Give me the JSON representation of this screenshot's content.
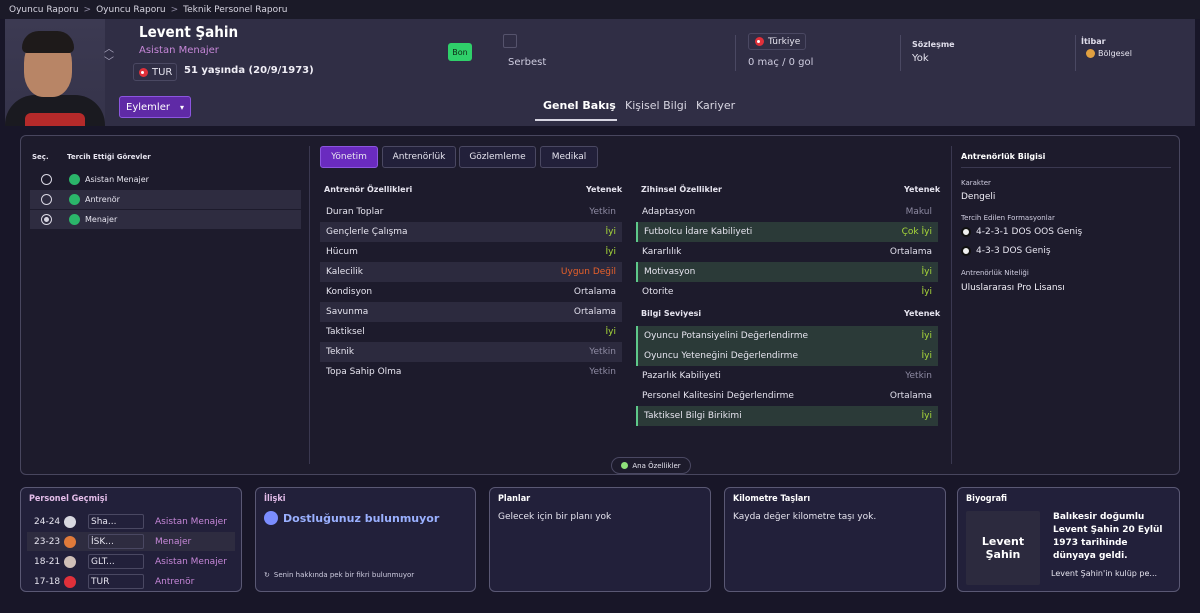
{
  "breadcrumb": [
    "Oyuncu Raporu",
    "Oyuncu Raporu",
    "Teknik Personel Raporu"
  ],
  "person": {
    "name": "Levent Şahin",
    "role": "Asistan Menajer",
    "nationality": "TUR",
    "age": "51 yaşında (20/9/1973)"
  },
  "header": {
    "badge": "Bon",
    "status": "Serbest",
    "club": "Türkiye",
    "matches": "0 maç / 0 gol",
    "contract_label": "Sözleşme",
    "contract_value": "Yok",
    "reputation_label": "İtibar",
    "reputation_value": "Bölgesel",
    "actions_label": "Eylemler"
  },
  "main_tabs": [
    "Genel Bakış",
    "Kişisel Bilgi",
    "Kariyer"
  ],
  "roles": {
    "col_select": "Seç.",
    "col_roles": "Tercih Ettiği Görevler",
    "items": [
      {
        "label": "Asistan Menajer",
        "selected": false
      },
      {
        "label": "Antrenör",
        "selected": false
      },
      {
        "label": "Menajer",
        "selected": true
      }
    ]
  },
  "sub_tabs": [
    "Yönetim",
    "Antrenörlük",
    "Gözlemleme",
    "Medikal"
  ],
  "coach_attrs": {
    "title": "Antrenör Özellikleri",
    "col": "Yetenek",
    "rows": [
      {
        "name": "Duran Toplar",
        "value": "Yetkin"
      },
      {
        "name": "Gençlerle Çalışma",
        "value": "İyi"
      },
      {
        "name": "Hücum",
        "value": "İyi"
      },
      {
        "name": "Kalecilik",
        "value": "Uygun Değil"
      },
      {
        "name": "Kondisyon",
        "value": "Ortalama"
      },
      {
        "name": "Savunma",
        "value": "Ortalama"
      },
      {
        "name": "Taktiksel",
        "value": "İyi"
      },
      {
        "name": "Teknik",
        "value": "Yetkin"
      },
      {
        "name": "Topa Sahip Olma",
        "value": "Yetkin"
      }
    ]
  },
  "mental_attrs": {
    "title": "Zihinsel Özellikler",
    "col": "Yetenek",
    "rows": [
      {
        "name": "Adaptasyon",
        "value": "Makul"
      },
      {
        "name": "Futbolcu İdare Kabiliyeti",
        "value": "Çok İyi"
      },
      {
        "name": "Kararlılık",
        "value": "Ortalama"
      },
      {
        "name": "Motivasyon",
        "value": "İyi"
      },
      {
        "name": "Otorite",
        "value": "İyi"
      }
    ]
  },
  "knowledge_attrs": {
    "title": "Bilgi Seviyesi",
    "col": "Yetenek",
    "rows": [
      {
        "name": "Oyuncu Potansiyelini Değerlendirme",
        "value": "İyi"
      },
      {
        "name": "Oyuncu Yeteneğini Değerlendirme",
        "value": "İyi"
      },
      {
        "name": "Pazarlık Kabiliyeti",
        "value": "Yetkin"
      },
      {
        "name": "Personel Kalitesini Değerlendirme",
        "value": "Ortalama"
      },
      {
        "name": "Taktiksel Bilgi Birikimi",
        "value": "İyi"
      }
    ]
  },
  "key_attrs_label": "Ana Özellikler",
  "coaching_info": {
    "title": "Antrenörlük Bilgisi",
    "character_label": "Karakter",
    "character_value": "Dengeli",
    "formations_label": "Tercih Edilen Formasyonlar",
    "formations": [
      "4-2-3-1 DOS OOS Geniş",
      "4-3-3 DOS Geniş"
    ],
    "qualification_label": "Antrenörlük Niteliği",
    "qualification_value": "Uluslararası Pro Lisansı"
  },
  "history": {
    "title": "Personel Geçmişi",
    "rows": [
      {
        "years": "24-24",
        "club": "Sha...",
        "role": "Asistan Menajer"
      },
      {
        "years": "23-23",
        "club": "İSK...",
        "role": "Menajer"
      },
      {
        "years": "18-21",
        "club": "GLT...",
        "role": "Asistan Menajer"
      },
      {
        "years": "17-18",
        "club": "TUR",
        "role": "Antrenör"
      }
    ]
  },
  "relationship": {
    "title": "İlişki",
    "main": "Dostluğunuz bulunmuyor",
    "sub": "Senin hakkında pek bir fikri bulunmuyor"
  },
  "plans": {
    "title": "Planlar",
    "text": "Gelecek için bir planı yok"
  },
  "milestones": {
    "title": "Kilometre Taşları",
    "text": "Kayda değer kilometre taşı yok."
  },
  "bio": {
    "title": "Biyografi",
    "image_text": "Levent Şahin",
    "headline": "Balıkesir doğumlu Levent Şahin 20 Eylül 1973 tarihinde dünyaya geldi.",
    "sub": "Levent Şahin'in kulüp pe..."
  }
}
